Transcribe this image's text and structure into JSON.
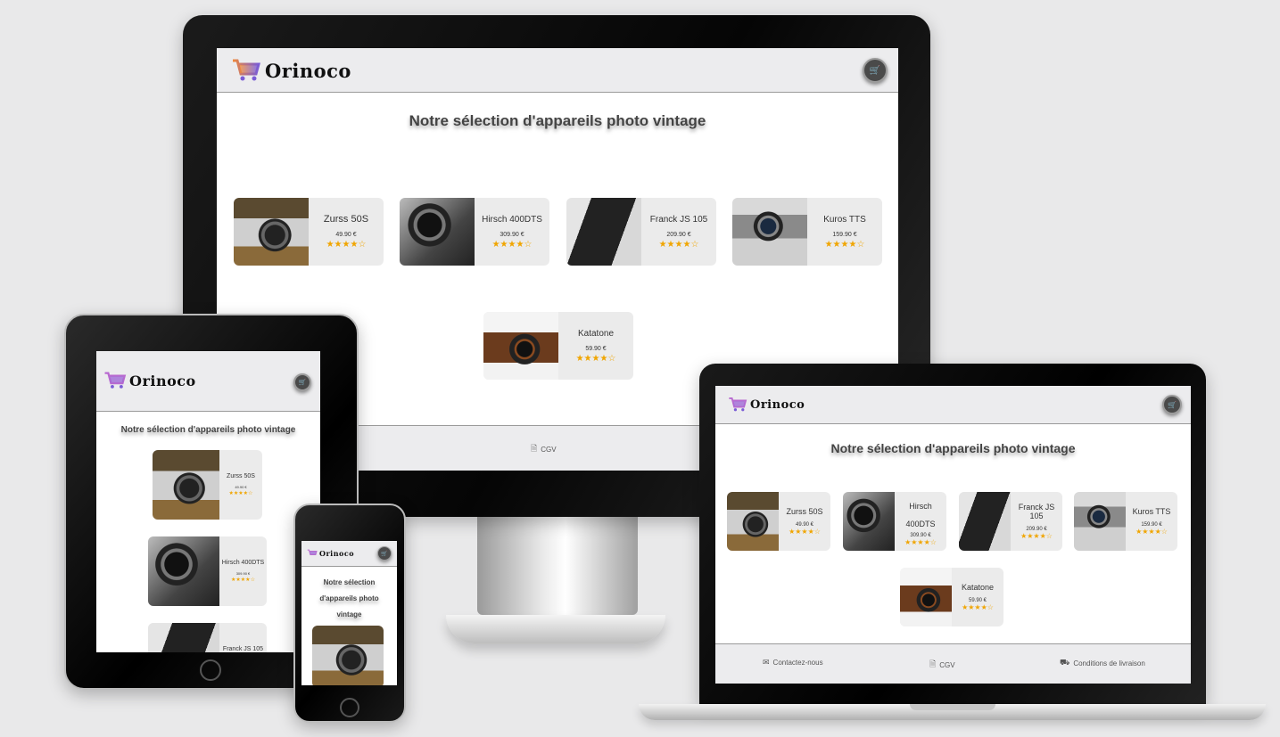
{
  "brand": {
    "name": "Orinoco"
  },
  "page": {
    "title": "Notre sélection d'appareils photo vintage",
    "title_mobile_lines": [
      "Notre sélection",
      "d'appareils photo",
      "vintage"
    ]
  },
  "products": [
    {
      "name": "Zurss 50S",
      "price": "49.90 €",
      "rating": 4,
      "stars": "★★★★☆",
      "thumb": "camera-zurss"
    },
    {
      "name": "Hirsch 400DTS",
      "price": "309.90 €",
      "rating": 4,
      "stars": "★★★★☆",
      "thumb": "camera-hirsch"
    },
    {
      "name": "Franck JS 105",
      "price": "209.90 €",
      "rating": 4,
      "stars": "★★★★☆",
      "thumb": "camera-franck"
    },
    {
      "name": "Kuros TTS",
      "price": "159.90 €",
      "rating": 4,
      "stars": "★★★★☆",
      "thumb": "camera-kuros"
    },
    {
      "name": "Katatone",
      "price": "59.90 €",
      "rating": 4,
      "stars": "★★★★☆",
      "thumb": "camera-katatone"
    }
  ],
  "laptop_names": [
    "Zurss 50S",
    "Hirsch\n400DTS",
    "Franck JS 105",
    "Kuros TTS",
    "Katatone"
  ],
  "footer": {
    "contact": "Contactez-nous",
    "cgv": "CGV",
    "delivery": "Conditions de livraison"
  },
  "icons": {
    "logo": "shopping-cart-icon",
    "cart": "cart-icon",
    "cgv": "document-icon",
    "contact": "envelope-icon",
    "delivery": "truck-icon"
  },
  "colors": {
    "star": "#f0a500",
    "header": "#ececee",
    "cart_button": "#4a4a4a"
  }
}
